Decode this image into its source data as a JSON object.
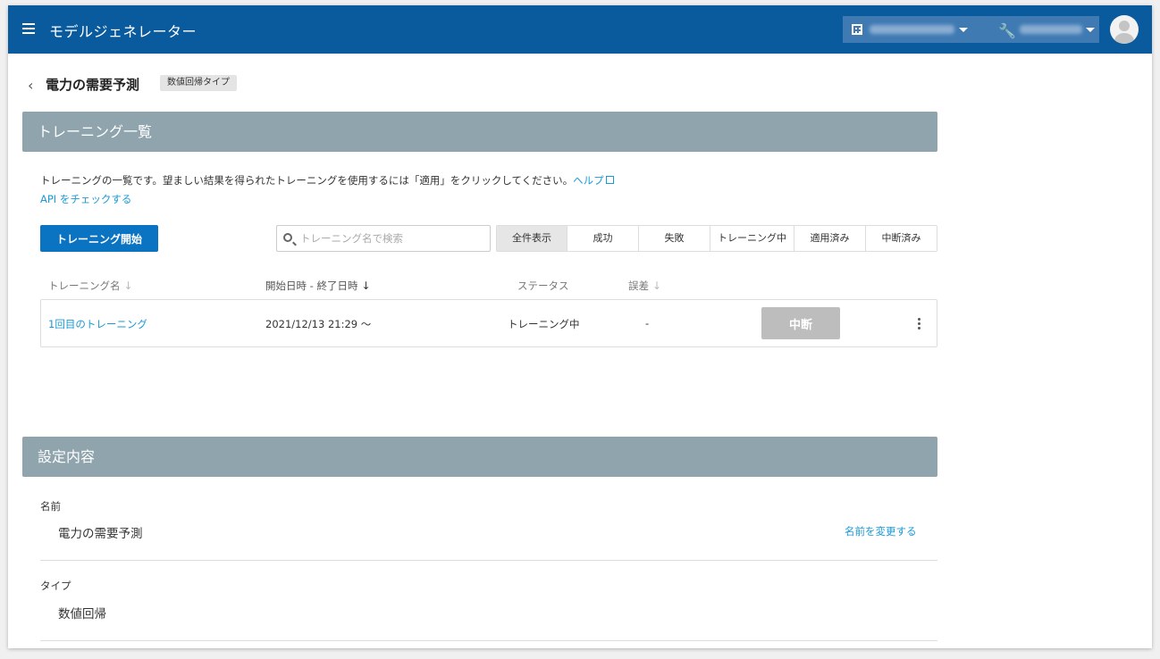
{
  "appbar": {
    "title": "モデルジェネレーター",
    "org_selector_icon": "building-icon",
    "project_selector_icon": "wrench-icon"
  },
  "page": {
    "title": "電力の需要予測",
    "type_badge": "数値回帰タイプ"
  },
  "training_section": {
    "header": "トレーニング一覧",
    "description": "トレーニングの一覧です。望ましい結果を得られたトレーニングを使用するには「適用」をクリックしてください。",
    "help_link": "ヘルプ",
    "api_link": "API をチェックする",
    "start_button": "トレーニング開始",
    "search_placeholder": "トレーニング名で検索",
    "filters": [
      "全件表示",
      "成功",
      "失敗",
      "トレーニング中",
      "適用済み",
      "中断済み"
    ],
    "active_filter": "全件表示",
    "columns": {
      "name": "トレーニング名",
      "period": "開始日時 - 終了日時",
      "status": "ステータス",
      "error": "誤差"
    },
    "rows": [
      {
        "name": "1回目のトレーニング",
        "period": "2021/12/13 21:29 〜",
        "status": "トレーニング中",
        "error": "-",
        "action": "中断"
      }
    ]
  },
  "settings_section": {
    "header": "設定内容",
    "name_label": "名前",
    "name_value": "電力の需要予測",
    "rename_link": "名前を変更する",
    "type_label": "タイプ",
    "type_value": "数値回帰"
  },
  "colors": {
    "appbar": "#0a5a9e",
    "section_header": "#8fa4ad",
    "primary_button": "#0a73c2",
    "link": "#1a9ad6",
    "disabled_button": "#bdbdbd"
  }
}
